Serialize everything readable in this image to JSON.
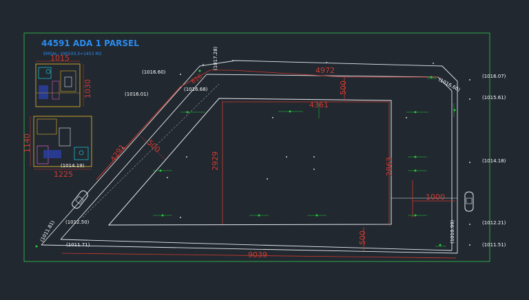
{
  "title": "44591 ADA 1 PARSEL",
  "subtitle": "EMSAL: 2905X0,5=1453 M2",
  "colors": {
    "background": "#212830",
    "frame": "#2ea84a",
    "parcel": "#e8ecef",
    "dimension": "#d43a2f",
    "title": "#2a8cf0",
    "marker": "#22d13a"
  },
  "elevations": {
    "e1016_60_left": "(1016.60)",
    "e1016_01": "(1016.01)",
    "e1016_68": "(1016.68)",
    "e1014_19": "(1014.19)",
    "e1012_50": "(1012.50)",
    "e1011_81": "(1011.81)",
    "e1011_71": "(1011.71)",
    "e1017_28": "(1017.28)",
    "e1016_07": "(1016.07)",
    "e1016_60_right": "(1016.60)",
    "e1015_61": "(1015.61)",
    "e1014_18": "(1014.18)",
    "e1012_21": "(1012.21)",
    "e1010_99": "(1010.99)",
    "e1011_51": "(1011.51)"
  },
  "dimensions": {
    "top_length": "4972",
    "inner_top_length": "4361",
    "bottom_length": "9039",
    "left_height": "2929",
    "right_height": "2863",
    "right_offset": "1000",
    "setback_top": "500",
    "setback_bottom": "500",
    "setback_diag": "500",
    "diag_length": "4291",
    "diag_small": "616",
    "plan_a_width": "1015",
    "plan_a_height": "1030",
    "plan_b_height": "1140",
    "plan_b_width": "1225"
  }
}
